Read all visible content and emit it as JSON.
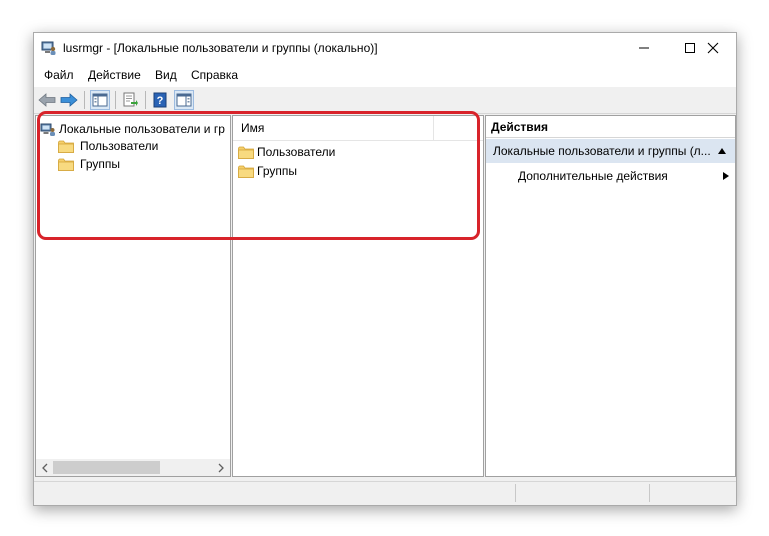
{
  "window": {
    "title": "lusrmgr - [Локальные пользователи и группы (локально)]",
    "controls": {
      "minimize": "—",
      "maximize": "☐",
      "close": "✕"
    }
  },
  "menu": {
    "items": [
      "Файл",
      "Действие",
      "Вид",
      "Справка"
    ]
  },
  "toolbar": {
    "icons": [
      "back-arrow-icon",
      "forward-arrow-icon",
      "show-hide-tree-icon",
      "export-list-icon",
      "help-icon",
      "show-hide-action-pane-icon"
    ]
  },
  "tree": {
    "root": "Локальные пользователи и группы (локально)",
    "root_visible": "Локальные пользователи и гр",
    "items": [
      "Пользователи",
      "Группы"
    ]
  },
  "list": {
    "column_header": "Имя",
    "items": [
      "Пользователи",
      "Группы"
    ]
  },
  "actions": {
    "header": "Действия",
    "section": "Локальные пользователи и группы (л...",
    "more": "Дополнительные действия"
  },
  "colors": {
    "accent_highlight": "#d8232a",
    "selection": "#dbe5f1",
    "folder": "#f0c75e"
  }
}
